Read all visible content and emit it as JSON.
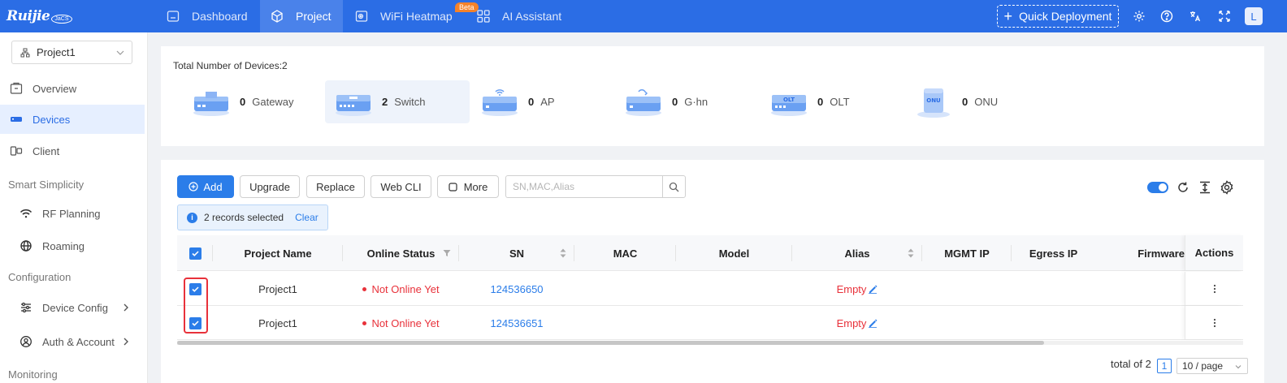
{
  "brand": {
    "logo_text": "Ruijie",
    "logo_badge": "JaCS"
  },
  "nav": {
    "items": [
      {
        "label": "Dashboard",
        "icon": "home-icon",
        "active": false
      },
      {
        "label": "Project",
        "icon": "cube-icon",
        "active": true
      },
      {
        "label": "WiFi Heatmap",
        "icon": "heatmap-icon",
        "active": false
      },
      {
        "label": "AI Assistant",
        "icon": "grid-icon",
        "active": false
      }
    ],
    "beta_badge": "Beta",
    "quick_deployment": "Quick Deployment",
    "avatar_letter": "L"
  },
  "sidebar": {
    "project_select": "Project1",
    "items": [
      {
        "label": "Overview",
        "icon": "overview-icon",
        "active": false
      },
      {
        "label": "Devices",
        "icon": "devices-icon",
        "active": true
      },
      {
        "label": "Client",
        "icon": "client-icon",
        "active": false
      }
    ],
    "group_smart": "Smart Simplicity",
    "smart_items": [
      {
        "label": "RF Planning",
        "icon": "wifi-icon"
      },
      {
        "label": "Roaming",
        "icon": "globe-icon"
      }
    ],
    "group_config": "Configuration",
    "config_items": [
      {
        "label": "Device Config",
        "icon": "sliders-icon"
      },
      {
        "label": "Auth & Account",
        "icon": "user-circle-icon"
      }
    ],
    "group_monitoring": "Monitoring"
  },
  "summary": {
    "total_label": "Total Number of Devices:2",
    "devices": [
      {
        "count": "0",
        "label": "Gateway"
      },
      {
        "count": "2",
        "label": "Switch"
      },
      {
        "count": "0",
        "label": "AP"
      },
      {
        "count": "0",
        "label": "G·hn"
      },
      {
        "count": "0",
        "label": "OLT"
      },
      {
        "count": "0",
        "label": "ONU"
      }
    ]
  },
  "toolbar": {
    "add": "Add",
    "upgrade": "Upgrade",
    "replace": "Replace",
    "webcli": "Web CLI",
    "more": "More",
    "search_placeholder": "SN,MAC,Alias"
  },
  "selection": {
    "text": "2 records selected",
    "clear": "Clear"
  },
  "table": {
    "headers": {
      "project_name": "Project Name",
      "online_status": "Online Status",
      "sn": "SN",
      "mac": "MAC",
      "model": "Model",
      "alias": "Alias",
      "mgmt_ip": "MGMT IP",
      "egress_ip": "Egress IP",
      "firmware": "Firmware",
      "actions": "Actions"
    },
    "rows": [
      {
        "project_name": "Project1",
        "online_status": "Not Online Yet",
        "sn": "124536650",
        "mac": "",
        "model": "",
        "alias": "Empty",
        "mgmt_ip": "",
        "egress_ip": "",
        "firmware": ""
      },
      {
        "project_name": "Project1",
        "online_status": "Not Online Yet",
        "sn": "124536651",
        "mac": "",
        "model": "",
        "alias": "Empty",
        "mgmt_ip": "",
        "egress_ip": "",
        "firmware": ""
      }
    ]
  },
  "pagination": {
    "total": "total of 2",
    "current_page": "1",
    "page_size": "10 / page"
  },
  "colors": {
    "primary": "#2b6de5",
    "accent": "#2b7de9",
    "danger": "#e8313a",
    "beta": "#f5822a"
  }
}
